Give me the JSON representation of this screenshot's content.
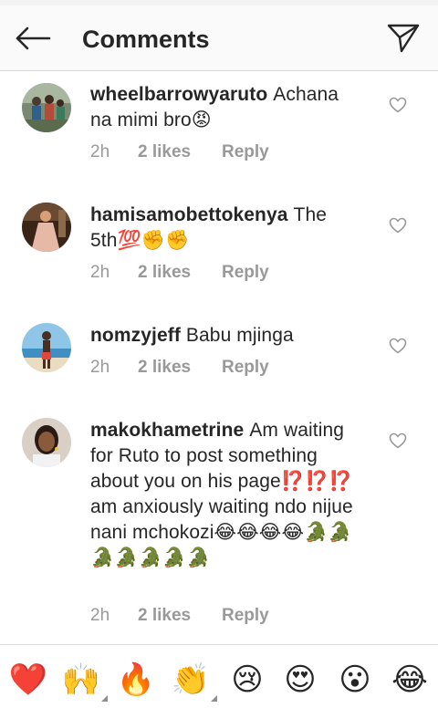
{
  "header": {
    "title": "Comments"
  },
  "comments": [
    {
      "username": "wheelbarrowyaruto",
      "body": "Achana na mimi bro😡",
      "time": "2h",
      "likes": "2 likes",
      "reply": "Reply"
    },
    {
      "username": "hamisamobettokenya",
      "body": "The 5th💯✊✊",
      "time": "2h",
      "likes": "2 likes",
      "reply": "Reply"
    },
    {
      "username": "nomzyjeff",
      "body": "Babu mjinga",
      "time": "2h",
      "likes": "2 likes",
      "reply": "Reply"
    },
    {
      "username": "makokhametrine",
      "body": "Am waiting for Ruto to post something about you on his page⁉️⁉️⁉️am anxiously waiting ndo nijue nani mchokozi😂😂😂😂🐊🐊🐊🐊🐊🐊🐊",
      "time": "2h",
      "likes": "2 likes",
      "reply": "Reply"
    }
  ],
  "emoji_bar": [
    {
      "glyph": "❤️",
      "name": "red-heart-emoji",
      "has_variants": false
    },
    {
      "glyph": "🙌",
      "name": "raising-hands-emoji",
      "has_variants": true
    },
    {
      "glyph": "🔥",
      "name": "fire-emoji",
      "has_variants": false
    },
    {
      "glyph": "👏",
      "name": "clapping-hands-emoji",
      "has_variants": true
    },
    {
      "glyph": "😢",
      "name": "crying-face-emoji",
      "has_variants": false
    },
    {
      "glyph": "😍",
      "name": "heart-eyes-emoji",
      "has_variants": false
    },
    {
      "glyph": "😮",
      "name": "surprised-face-emoji",
      "has_variants": false
    },
    {
      "glyph": "😂",
      "name": "tears-of-joy-emoji",
      "has_variants": false
    }
  ],
  "colors": {
    "text": "#262626",
    "meta": "#999999",
    "divider": "#dbdbdb",
    "header_bg": "#fafafa"
  }
}
